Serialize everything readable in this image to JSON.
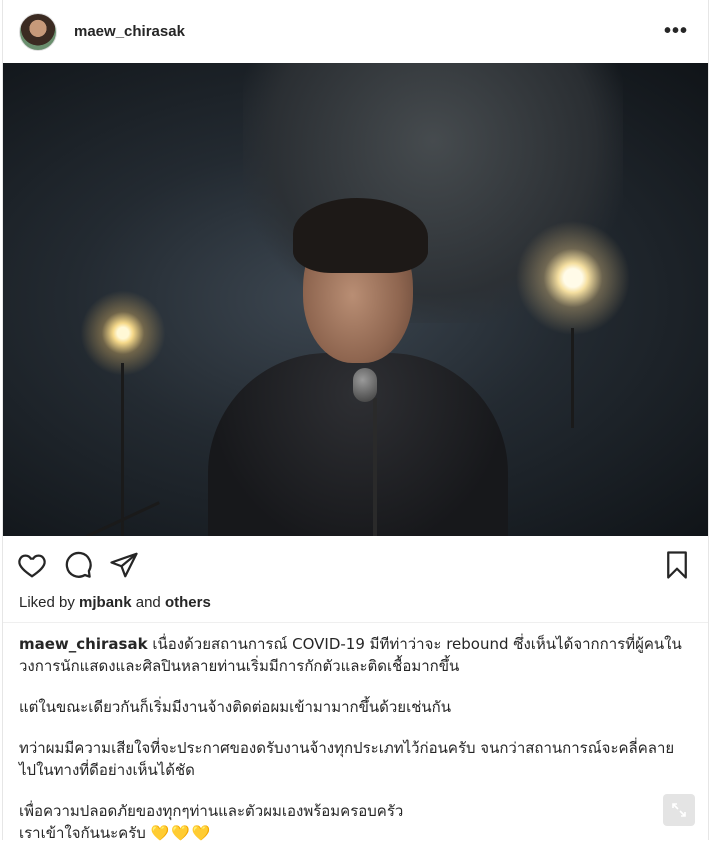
{
  "header": {
    "username": "maew_chirasak",
    "more_label": "•••"
  },
  "photo": {
    "alt": "Man singing into a vintage microphone in a dark cave with stage lights"
  },
  "actions": {
    "icons": [
      "heart-icon",
      "comment-icon",
      "share-icon",
      "bookmark-icon"
    ]
  },
  "likes": {
    "prefix": "Liked by",
    "user": "mjbank",
    "connector": "and",
    "others": "others"
  },
  "caption": {
    "username": "maew_chirasak",
    "line1_text": " เนื่องด้วยสถานการณ์ COVID-19 มีทีท่าว่าจะ rebound ซึ่งเห็นได้จากการที่ผู้คนใน",
    "line2": "วงการนักแสดงและศิลปินหลายท่านเริ่มมีการกักตัวและติดเชื้อมากขึ้น",
    "para2": "แต่ในขณะเดียวกันก็เริ่มมีงานจ้างติดต่อผมเข้ามามากขึ้นด้วยเช่นกัน",
    "para3_line1": "ทว่าผมมีความเสียใจที่จะประกาศของดรับงานจ้างทุกประเภทไว้ก่อนครับ จนกว่าสถานการณ์จะคลี่คลาย",
    "para3_line2": "ไปในทางที่ดีอย่างเห็นได้ชัด",
    "para4_line1": "เพื่อความปลอดภัยของทุกๆท่านและตัวผมเองพร้อมครอบครัว",
    "para4_line2": "เราเข้าใจกันนะครับ",
    "hearts": "💛💛💛"
  },
  "colors": {
    "text": "#262626",
    "heart_yellow": "#f0c419",
    "divider": "#efefef"
  }
}
